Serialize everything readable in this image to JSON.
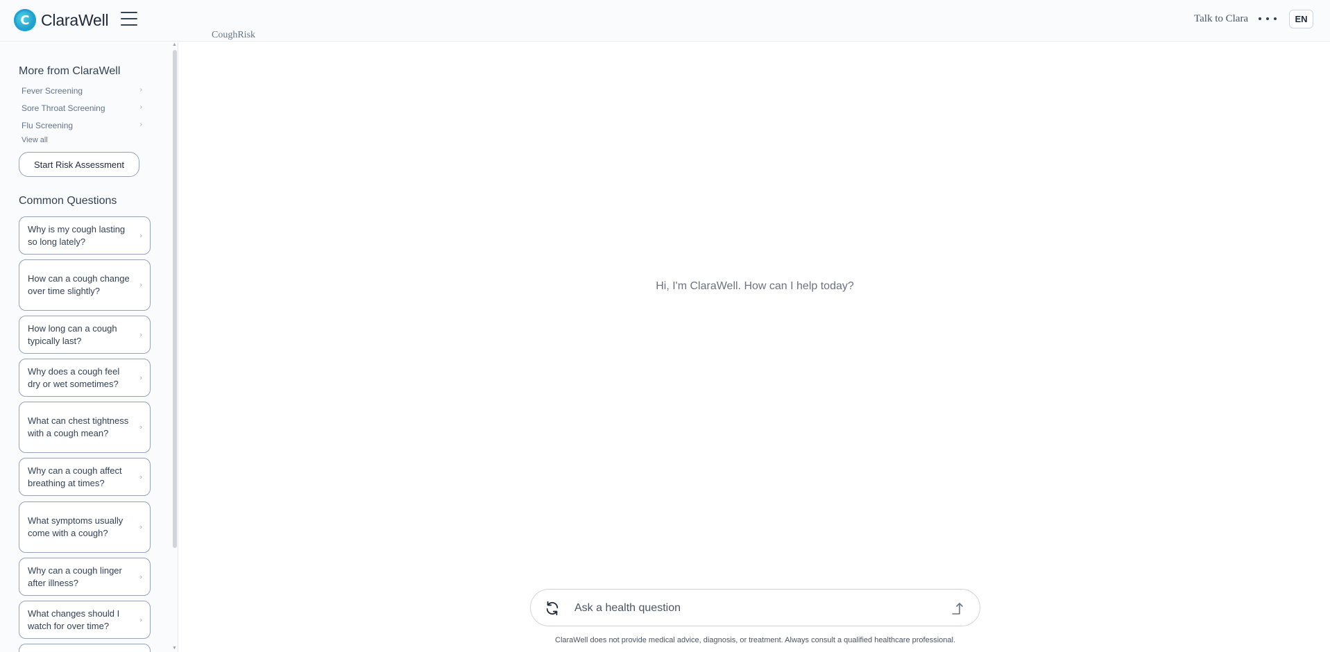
{
  "header": {
    "brand": "ClaraWell",
    "logo_letter": "C",
    "breadcrumb": "CoughRisk",
    "talk_label": "Talk to Clara",
    "lang_label": "EN"
  },
  "sidebar": {
    "more_title": "More from ClaraWell",
    "more_items": [
      {
        "label": "Fever Screening"
      },
      {
        "label": "Sore Throat Screening"
      },
      {
        "label": "Flu Screening"
      }
    ],
    "view_all": "View all",
    "start_button": "Start Risk Assessment",
    "questions_title": "Common Questions",
    "questions": [
      {
        "text": "Why is my cough lasting so long lately?"
      },
      {
        "text": "How can a cough change over time slightly?"
      },
      {
        "text": "How long can a cough typically last?"
      },
      {
        "text": "Why does a cough feel dry or wet sometimes?"
      },
      {
        "text": "What can chest tightness with a cough mean?"
      },
      {
        "text": "Why can a cough affect breathing at times?"
      },
      {
        "text": "What symptoms usually come with a cough?"
      },
      {
        "text": "Why can a cough linger after illness?"
      },
      {
        "text": "What changes should I watch for over time?"
      }
    ]
  },
  "main": {
    "greeting": "Hi, I'm ClaraWell. How can I help today?",
    "input_placeholder": "Ask a health question",
    "disclaimer": "ClaraWell does not provide medical advice, diagnosis, or treatment. Always consult a qualified healthcare professional."
  },
  "colors": {
    "brand_cyan": "#1aa3d4",
    "border": "#94a3b8",
    "text": "#334155"
  },
  "icons": {
    "menu": "hamburger-menu-icon",
    "more": "more-dots-icon",
    "refresh": "refresh-icon",
    "send": "send-arrow-icon",
    "chevron": "chevron-right-icon"
  }
}
